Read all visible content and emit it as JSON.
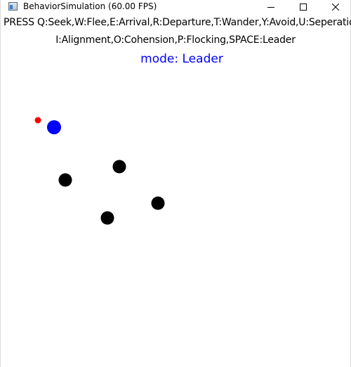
{
  "window": {
    "title": "BehaviorSimulation (60.00 FPS)",
    "app_icon": "application-window-icon",
    "controls": {
      "minimize_icon": "minimize-icon",
      "maximize_icon": "maximize-icon",
      "close_icon": "close-icon"
    }
  },
  "instructions": {
    "line1": "PRESS Q:Seek,W:Flee,E:Arrival,R:Departure,T:Wander,Y:Avoid,U:Seperation",
    "line2": "I:Alignment,O:Cohension,P:Flocking,SPACE:Leader"
  },
  "mode": {
    "text": "mode: Leader",
    "color": "#0000ff"
  },
  "scene": {
    "target_color": "#ff0000",
    "leader_color": "#0000ff",
    "follower_color": "#000000",
    "entities": [
      {
        "name": "target-dot",
        "role": "target"
      },
      {
        "name": "leader-boid",
        "role": "leader"
      },
      {
        "name": "follower-boid",
        "role": "follower"
      },
      {
        "name": "follower-boid",
        "role": "follower"
      },
      {
        "name": "follower-boid",
        "role": "follower"
      },
      {
        "name": "follower-boid",
        "role": "follower"
      }
    ]
  }
}
